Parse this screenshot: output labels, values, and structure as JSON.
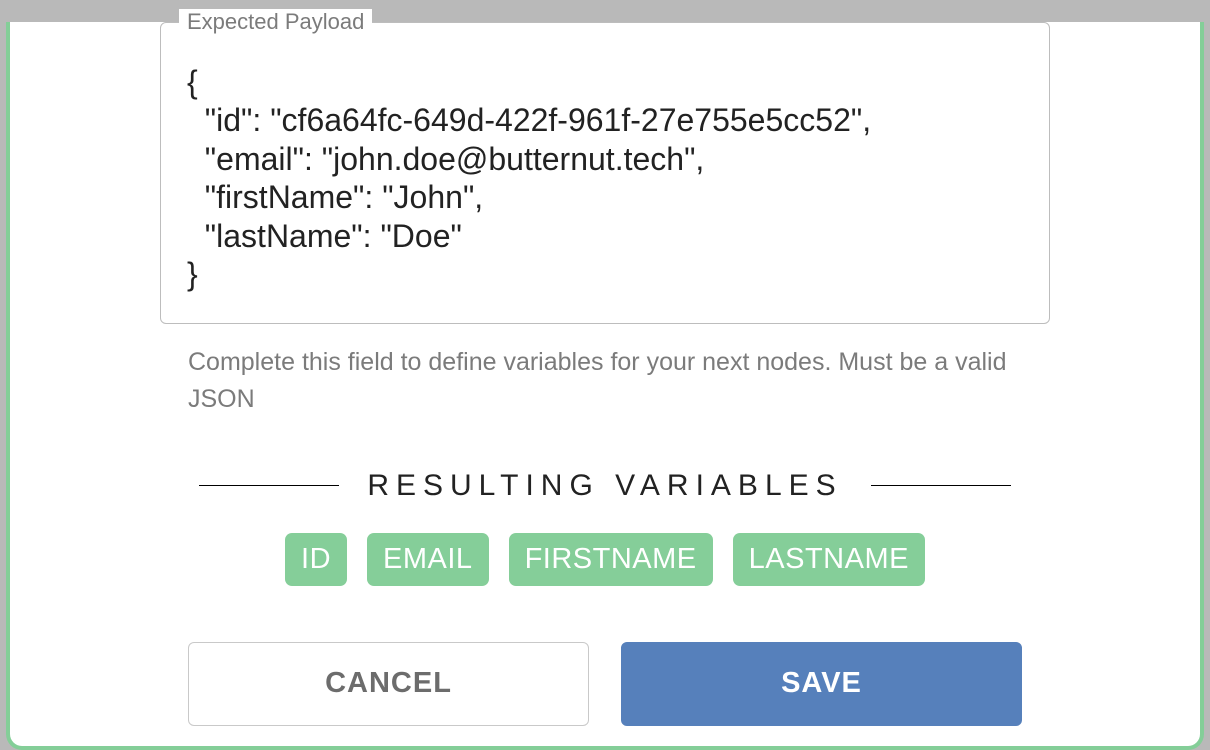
{
  "payload_field": {
    "legend": "Expected Payload",
    "value": "{\n  \"id\": \"cf6a64fc-649d-422f-961f-27e755e5cc52\",\n  \"email\": \"john.doe@butternut.tech\",\n  \"firstName\": \"John\",\n  \"lastName\": \"Doe\"\n}",
    "helper": "Complete this field to define variables for your next nodes. Must be a valid JSON"
  },
  "resulting_variables": {
    "heading": "RESULTING VARIABLES",
    "chips": [
      "ID",
      "EMAIL",
      "FIRSTNAME",
      "LASTNAME"
    ]
  },
  "buttons": {
    "cancel": "CANCEL",
    "save": "SAVE"
  }
}
